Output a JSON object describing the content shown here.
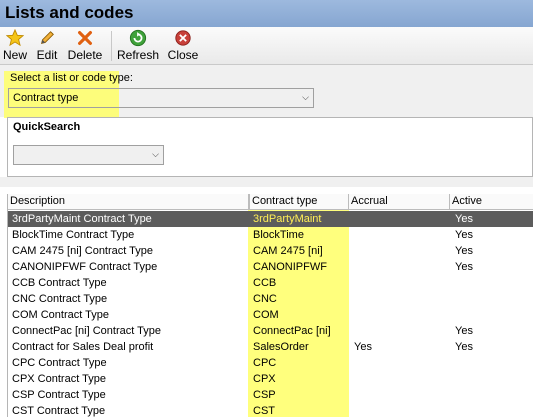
{
  "window": {
    "title": "Lists and codes"
  },
  "toolbar": {
    "new_label": "New",
    "edit_label": "Edit",
    "delete_label": "Delete",
    "refresh_label": "Refresh",
    "close_label": "Close"
  },
  "selector": {
    "label": "Select a list or code type:",
    "value": "Contract type"
  },
  "quicksearch": {
    "title": "QuickSearch",
    "value": ""
  },
  "grid": {
    "columns": [
      "Description",
      "Contract type",
      "Accrual",
      "Active"
    ],
    "rows": [
      {
        "description": "3rdPartyMaint Contract Type",
        "contract_type": "3rdPartyMaint",
        "accrual": "",
        "active": "Yes",
        "selected": true
      },
      {
        "description": "BlockTime Contract Type",
        "contract_type": "BlockTime",
        "accrual": "",
        "active": "Yes"
      },
      {
        "description": "CAM 2475 [ni] Contract Type",
        "contract_type": "CAM 2475 [ni]",
        "accrual": "",
        "active": "Yes"
      },
      {
        "description": "CANONIPFWF Contract Type",
        "contract_type": "CANONIPFWF",
        "accrual": "",
        "active": "Yes"
      },
      {
        "description": "CCB Contract Type",
        "contract_type": "CCB",
        "accrual": "",
        "active": ""
      },
      {
        "description": "CNC Contract Type",
        "contract_type": "CNC",
        "accrual": "",
        "active": ""
      },
      {
        "description": "COM Contract Type",
        "contract_type": "COM",
        "accrual": "",
        "active": ""
      },
      {
        "description": "ConnectPac [ni] Contract Type",
        "contract_type": "ConnectPac [ni]",
        "accrual": "",
        "active": "Yes"
      },
      {
        "description": "Contract for Sales Deal profit",
        "contract_type": "SalesOrder",
        "accrual": "Yes",
        "active": "Yes"
      },
      {
        "description": "CPC Contract Type",
        "contract_type": "CPC",
        "accrual": "",
        "active": ""
      },
      {
        "description": "CPX Contract Type",
        "contract_type": "CPX",
        "accrual": "",
        "active": ""
      },
      {
        "description": "CSP Contract Type",
        "contract_type": "CSP",
        "accrual": "",
        "active": ""
      },
      {
        "description": "CST Contract Type",
        "contract_type": "CST",
        "accrual": "",
        "active": ""
      }
    ]
  },
  "colors": {
    "highlight": "#ffff66",
    "selected_row": "#5c5c5c",
    "titlebar": "#8eaed8"
  }
}
